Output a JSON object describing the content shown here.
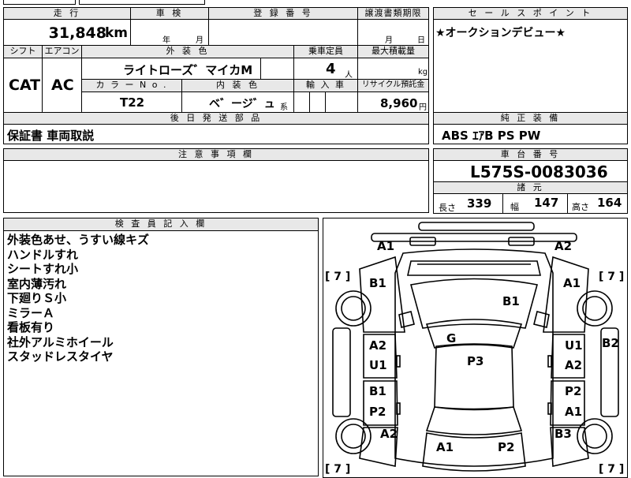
{
  "top_strip": {
    "text_a": "ー",
    "text_b": "回刃刃"
  },
  "vehicle": {
    "mileage_label": "走 行",
    "mileage": "31,848",
    "mileage_unit": "km",
    "inspection_label": "車 検",
    "inspection_year": "年",
    "inspection_month": "月",
    "registration_label": "登 録 番 号",
    "registration_value": "",
    "transfer_label": "譲渡書類期限",
    "transfer_month": "月",
    "transfer_day": "日",
    "shift_label": "シフト",
    "shift": "CAT",
    "ac_label": "エアコン",
    "ac": "AC",
    "exterior_color_label": "外 装 色",
    "exterior_color": "ライトローズ゛マイカM",
    "capacity_label": "乗車定員",
    "capacity": "4",
    "capacity_unit": "人",
    "max_load_label": "最大積載量",
    "max_load_unit": "kg",
    "color_no_label": "カ ラ ー N o .",
    "color_no": "T22",
    "interior_color_label": "内 装 色",
    "interior_color": "ベ゛ージ゛ュ",
    "interior_suffix": "系",
    "import_label": "輸 入 車",
    "recycle_label": "リサイクル預託金",
    "recycle_fee": "8,960",
    "recycle_unit": "円",
    "later_parts_label": "後 日 発 送 部 品",
    "later_parts": "保証書 車両取説"
  },
  "sales_point": {
    "label": "セ ー ル ス ポ イ ン ト",
    "text": "★オークションデビュー★"
  },
  "standard_equipment": {
    "label": "純 正 装 備",
    "text": "ABS ｴｱB PS PW"
  },
  "notes": {
    "label": "注 意 事 項 欄",
    "text": ""
  },
  "chassis": {
    "label": "車 台 番 号",
    "number": "L575S-0083036"
  },
  "specs": {
    "label": "諸 元",
    "length_label": "長さ",
    "length": "339",
    "width_label": "幅",
    "width": "147",
    "height_label": "高さ",
    "height": "164"
  },
  "inspector": {
    "label": "検 査 員 記 入 欄",
    "remarks": [
      "外装色あせ、うすい線キズ",
      "ハンドルすれ",
      "シートすれ小",
      "室内薄汚れ",
      "下廻りＳ小",
      "ミラーＡ",
      "看板有り",
      "社外アルミホイール",
      "スタッドレスタイヤ"
    ]
  },
  "diagram": {
    "codes": {
      "front_left": "A1",
      "front_right": "A2",
      "fender_left": "B1",
      "fender_right": "A1",
      "hood": "B1",
      "windshield": "G",
      "roof": "P3",
      "side_b2": "B2",
      "left_front_door_1": "A2",
      "left_front_door_2": "U1",
      "right_front_door_1": "U1",
      "right_front_door_2": "A2",
      "left_rear_door_1": "B1",
      "left_rear_door_2": "P2",
      "right_rear_door_1": "P2",
      "right_rear_door_2": "A1",
      "rear_left_quarter": "A2",
      "rear_right_quarter": "B3",
      "rear_left": "A1",
      "rear_right": "P2"
    },
    "tire_tl": "[ 7 ]",
    "tire_tr": "[ 7 ]",
    "tire_bl": "[ 7 ]",
    "tire_br": "[ 7 ]"
  }
}
